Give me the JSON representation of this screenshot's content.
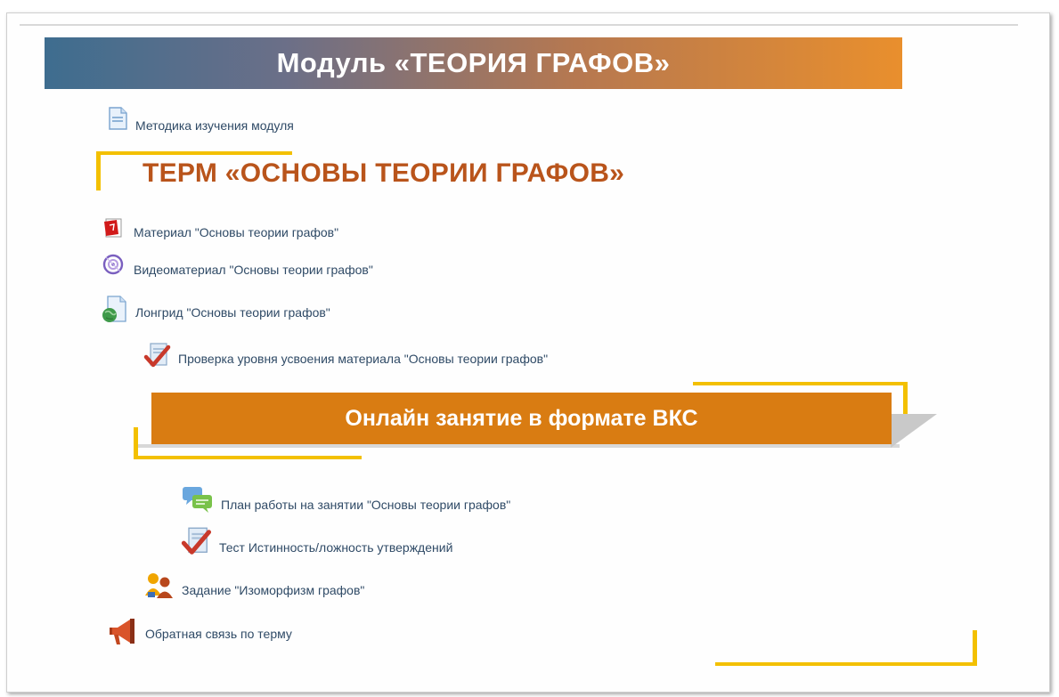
{
  "module_banner": "Модуль «ТЕОРИЯ ГРАФОВ»",
  "module_method_link": "Методика изучения модуля",
  "term_title": "ТЕРМ «ОСНОВЫ ТЕОРИИ ГРАФОВ»",
  "term_items": [
    {
      "label": "Материал \"Основы теории графов\"",
      "icon": "pdf-file-icon"
    },
    {
      "label": "Видеоматериал \"Основы теории графов\"",
      "icon": "video-icon"
    },
    {
      "label": "Лонгрид \"Основы теории графов\"",
      "icon": "web-page-icon"
    },
    {
      "label": "Проверка уровня усвоения материала \"Основы теории графов\"",
      "icon": "quiz-check-icon"
    }
  ],
  "vks_banner": "Онлайн занятие в формате ВКС",
  "vks_items": [
    {
      "label": "План работы на занятии \"Основы теории графов\"",
      "icon": "chat-bubbles-icon"
    },
    {
      "label": "Тест Истинность/ложность утверждений",
      "icon": "quiz-check-icon"
    }
  ],
  "assignment": {
    "label": "Задание \"Изоморфизм графов\"",
    "icon": "workshop-users-icon"
  },
  "feedback": {
    "label": "Обратная связь по терму",
    "icon": "megaphone-icon"
  },
  "colors": {
    "banner_gradient_start": "#3e6d8f",
    "banner_gradient_end": "#e98f2d",
    "term_title": "#b9541b",
    "vks_banner": "#d97c12",
    "accent_yellow": "#f3c000",
    "link": "#2f4a66"
  }
}
